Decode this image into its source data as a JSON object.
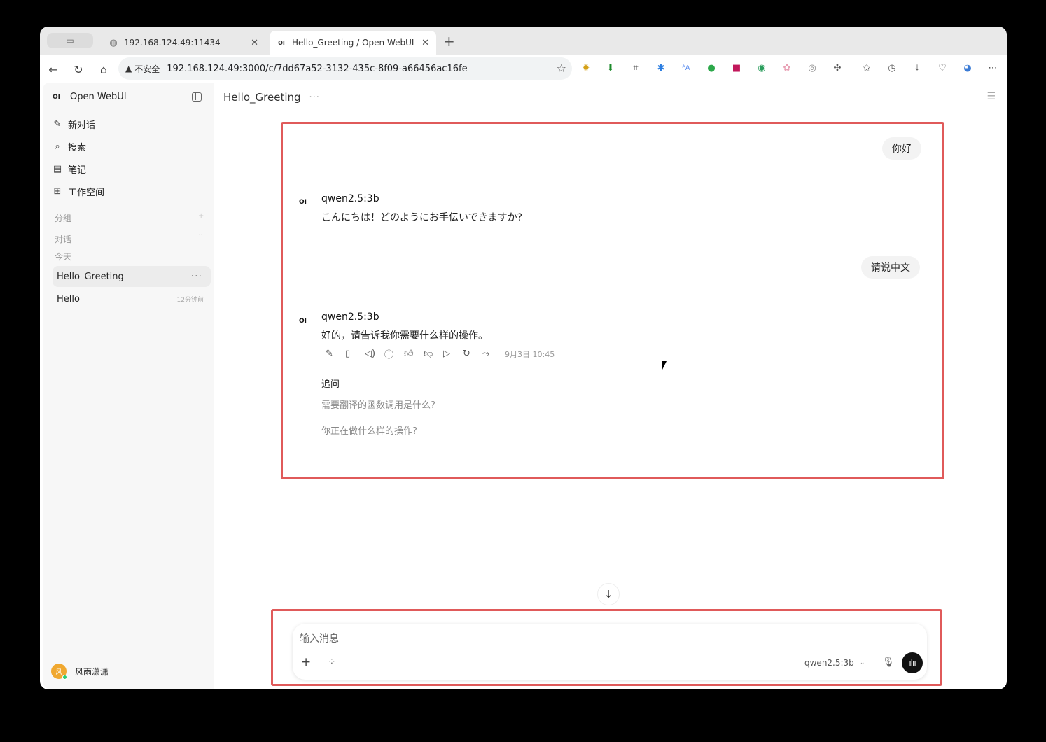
{
  "browser": {
    "tabs": [
      {
        "title": "192.168.124.49:11434"
      },
      {
        "title": "Hello_Greeting / Open WebUI"
      }
    ],
    "new_tab": "+",
    "address": {
      "security_label": "不安全",
      "url": "192.168.124.49:3000/c/7dd67a52-3132-435c-8f09-a66456ac16fe"
    }
  },
  "sidebar": {
    "brand": "Open WebUI",
    "brand_logo": "OI",
    "nav": [
      {
        "label": "新对话",
        "icon": "pencil-icon"
      },
      {
        "label": "搜索",
        "icon": "search-icon"
      },
      {
        "label": "笔记",
        "icon": "notebook-icon"
      },
      {
        "label": "工作空间",
        "icon": "grid-icon"
      }
    ],
    "sections": {
      "groups": "分组",
      "chats": "对话",
      "today": "今天"
    },
    "chats": [
      {
        "title": "Hello_Greeting",
        "time": ""
      },
      {
        "title": "Hello",
        "time": "12分钟前"
      }
    ],
    "user": {
      "name": "风雨潇潇",
      "initial": "风"
    }
  },
  "header": {
    "title": "Hello_Greeting",
    "more": "···"
  },
  "messages": {
    "user_1": "你好",
    "ai_1": {
      "model": "qwen2.5:3b",
      "logo": "OI",
      "text": "こんにちは！どのようにお手伝いできますか?"
    },
    "user_2": "请说中文",
    "ai_2": {
      "model": "qwen2.5:3b",
      "logo": "OI",
      "text": "好的，请告诉我你需要什么样的操作。",
      "timestamp": "9月3日 10:45"
    }
  },
  "followups": {
    "title": "追问",
    "items": [
      "需要翻译的函数调用是什么?",
      "你正在做什么样的操作?"
    ]
  },
  "composer": {
    "placeholder": "输入消息",
    "model": "qwen2.5:3b"
  },
  "colors": {
    "highlight": "#e05a5a",
    "avatar": "#f0a830",
    "online": "#2ecc71"
  }
}
